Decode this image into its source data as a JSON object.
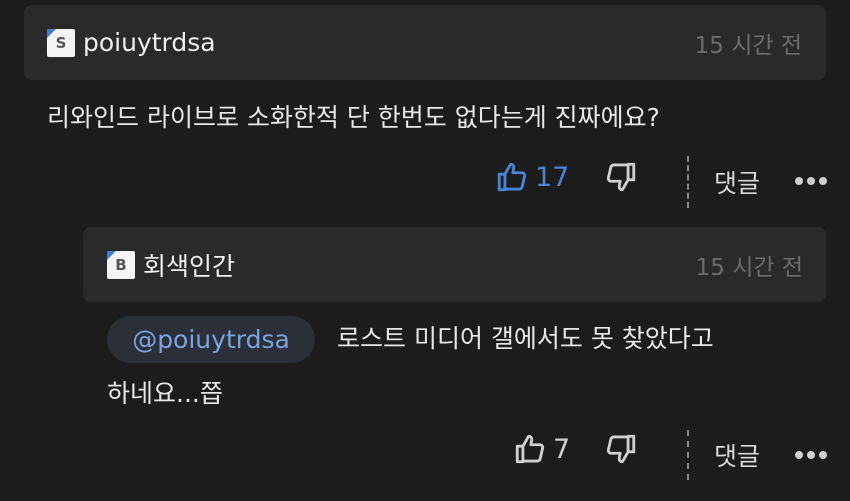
{
  "comments": [
    {
      "level_badge": "S",
      "username": "poiuytrdsa",
      "time": "15 시간 전",
      "text": "리와인드 라이브로 소화한적 단 한번도 없다는게 진짜에요?",
      "likes": "17",
      "reply_label": "댓글"
    },
    {
      "level_badge": "B",
      "username": "회색인간",
      "time": "15 시간 전",
      "mention": "@poiuytrdsa",
      "text_line1": "로스트 미디어 갤에서도 못 찾았다고",
      "text_line2": "하네요...쯥",
      "likes": "7",
      "reply_label": "댓글"
    }
  ],
  "colors": {
    "background": "#1c1c1c",
    "header": "#2a2a2a",
    "accent_like": "#4a84d8",
    "mention_text": "#7aa3e2"
  },
  "icons": [
    "thumbs-up-icon",
    "thumbs-down-icon",
    "more-options-icon"
  ]
}
